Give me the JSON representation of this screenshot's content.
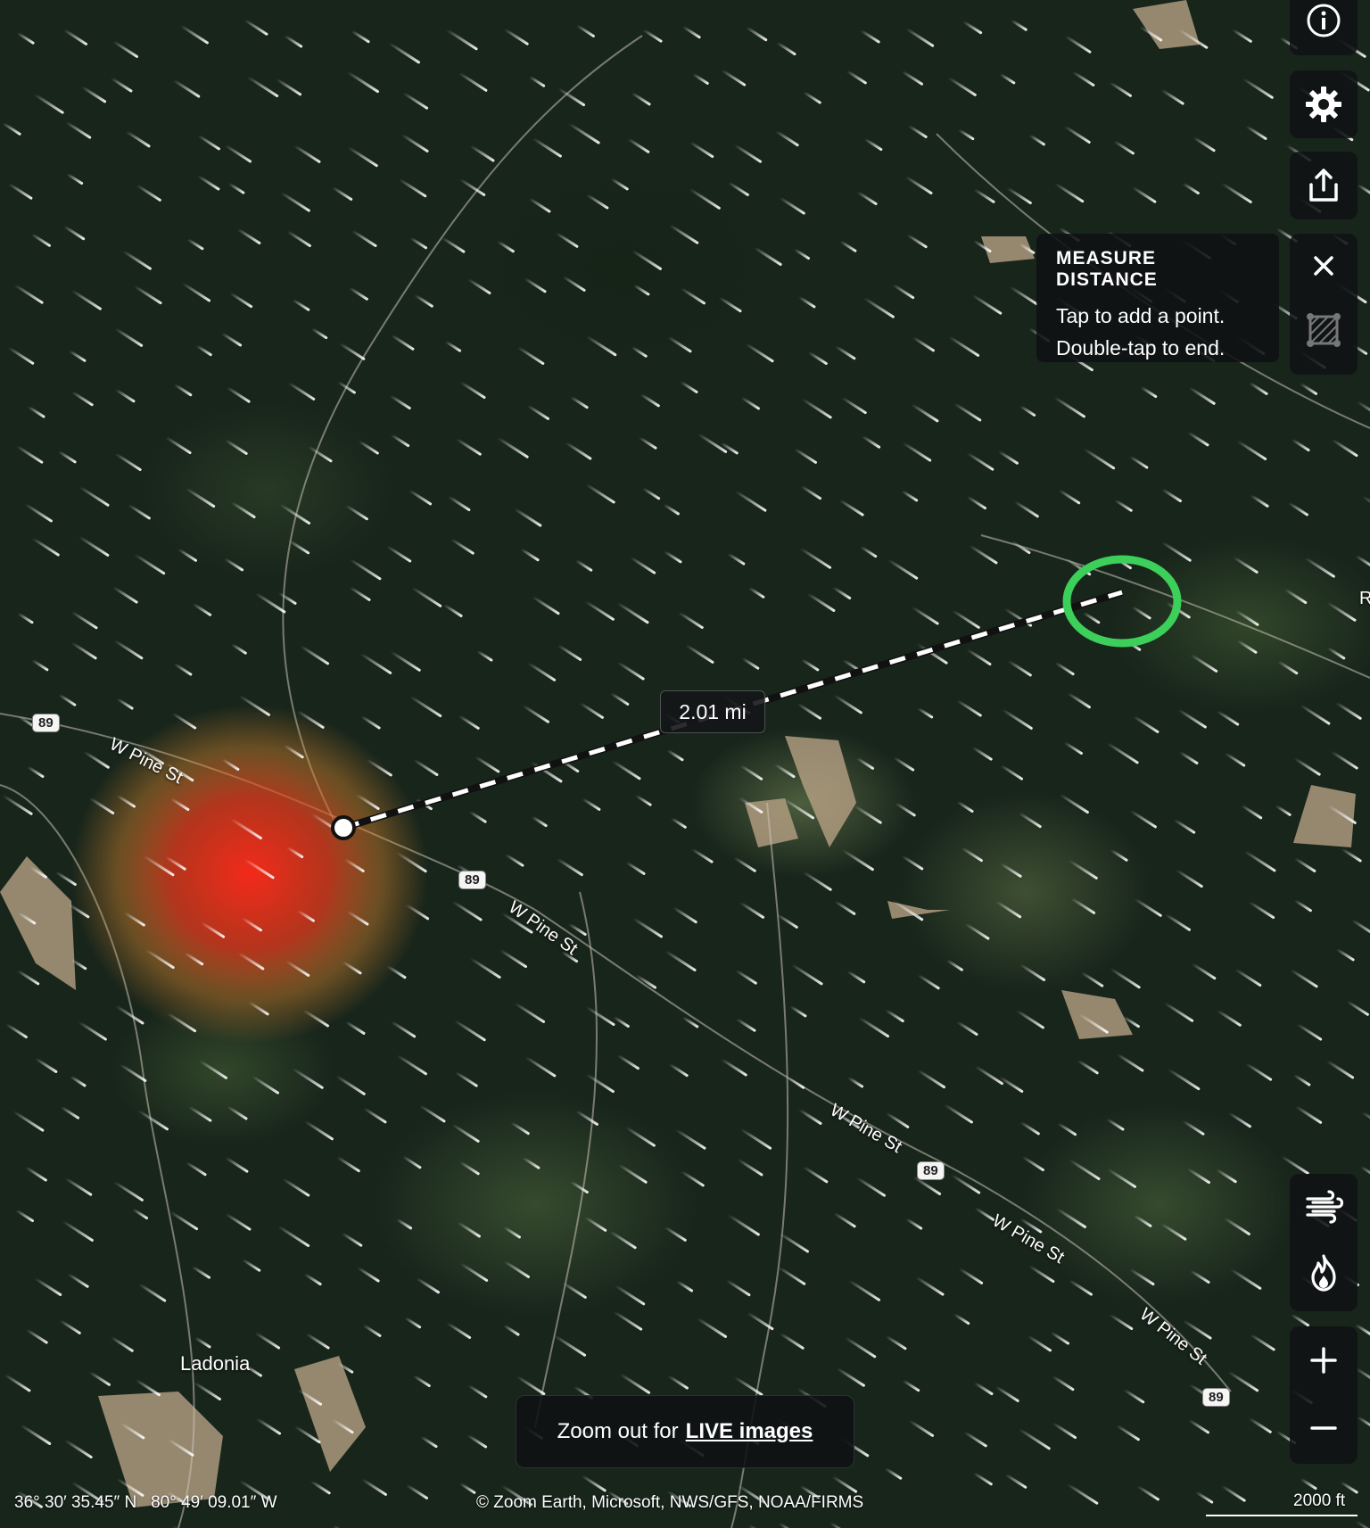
{
  "map": {
    "roads": [
      {
        "label": "W Pine St",
        "shield": "89"
      },
      {
        "label": "W Pine St",
        "shield": "89"
      },
      {
        "label": "W Pine St",
        "shield": "89"
      },
      {
        "label": "W Pine St",
        "shield": ""
      },
      {
        "label": "W Pine St",
        "shield": "89"
      }
    ],
    "town_label": "Ladonia",
    "edge_label": "R",
    "measure_line_color": "#ffffff",
    "end_marker_color": "#3ccf5a",
    "fire_heat_color": "#ff2a1a"
  },
  "measurement": {
    "distance": "2.01 mi"
  },
  "tooltip": {
    "title": "MEASURE DISTANCE",
    "line1": "Tap to add a point.",
    "line2": "Double-tap to end."
  },
  "controls": {
    "info_icon": "info-icon",
    "settings_icon": "gear-icon",
    "share_icon": "share-icon",
    "close_icon": "close-icon",
    "area_icon": "area-measure-icon",
    "wind_icon": "wind-icon",
    "fire_icon": "fire-icon",
    "zoom_in_icon": "plus-icon",
    "zoom_out_icon": "minus-icon"
  },
  "live_banner": {
    "prefix": "Zoom out for",
    "link": "LIVE images"
  },
  "footer": {
    "coordinates": "36° 30′ 35.45″ N   80° 49′ 09.01″ W",
    "attribution": "© Zoom Earth, Microsoft, NWS/GFS, NOAA/FIRMS",
    "scale": "2000 ft"
  }
}
